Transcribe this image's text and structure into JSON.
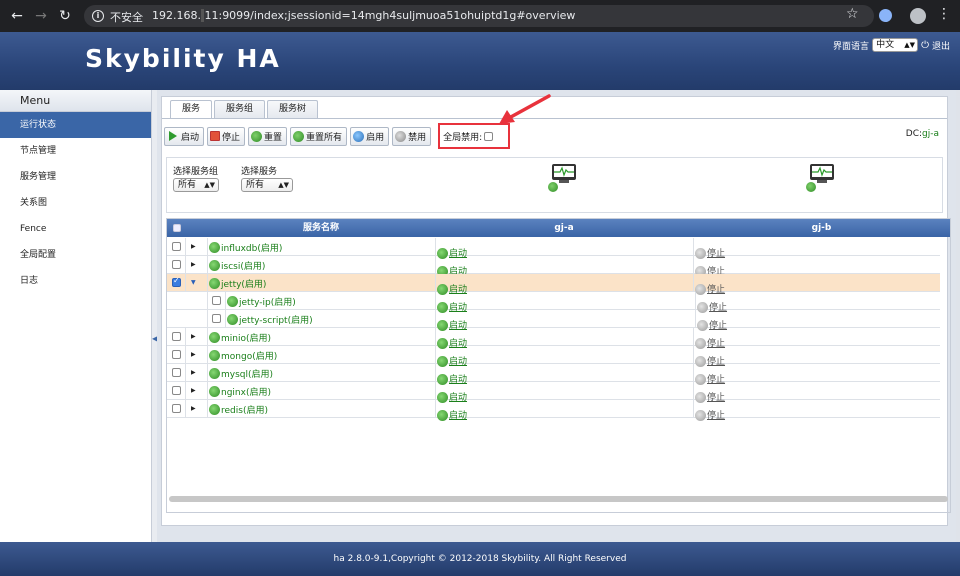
{
  "browser": {
    "insecure_label": "不安全",
    "url_host": "192.168.",
    "url_masked": "   ",
    "url_rest": "11:9099/index;jsessionid=14mgh4suljmuoa51ohuiptd1g#overview"
  },
  "header": {
    "logo": "Skybility HA",
    "lang_label": "界面语言",
    "lang_value": "中文",
    "logout_label": "退出"
  },
  "sidebar": {
    "title": "Menu",
    "items": [
      {
        "label": "运行状态",
        "active": true
      },
      {
        "label": "节点管理"
      },
      {
        "label": "服务管理"
      },
      {
        "label": "关系图"
      },
      {
        "label": "Fence"
      },
      {
        "label": "全局配置"
      },
      {
        "label": "日志"
      }
    ]
  },
  "tabs": [
    "服务",
    "服务组",
    "服务树"
  ],
  "toolbar": {
    "start": "启动",
    "stop": "停止",
    "reset": "重置",
    "reset_all": "重置所有",
    "enable": "启用",
    "disable": "禁用",
    "global_disable": "全局禁用:",
    "dc_label": "DC:",
    "dc_value": "gj-a"
  },
  "filters": {
    "group_label": "选择服务组",
    "group_value": "所有",
    "service_label": "选择服务",
    "service_value": "所有"
  },
  "grid": {
    "col_name": "服务名称",
    "col_node1": "gj-a",
    "col_node2": "gj-b",
    "rows": [
      {
        "name": "influxdb(启用)",
        "a": "启动",
        "b": "停止"
      },
      {
        "name": "iscsi(启用)",
        "a": "启动",
        "b": "停止"
      },
      {
        "name": "jetty(启用)",
        "a": "启动",
        "b": "停止"
      },
      {
        "name": "jetty-ip(启用)",
        "a": "启动",
        "b": "停止"
      },
      {
        "name": "jetty-script(启用)",
        "a": "启动",
        "b": "停止"
      },
      {
        "name": "minio(启用)",
        "a": "启动",
        "b": "停止"
      },
      {
        "name": "mongo(启用)",
        "a": "启动",
        "b": "停止"
      },
      {
        "name": "mysql(启用)",
        "a": "启动",
        "b": "停止"
      },
      {
        "name": "nginx(启用)",
        "a": "启动",
        "b": "停止"
      },
      {
        "name": "redis(启用)",
        "a": "启动",
        "b": "停止"
      }
    ]
  },
  "footer": "ha 2.8.0-9.1,Copyright © 2012-2018 Skybility. All Right Reserved",
  "colors": {
    "brand": "#2a4579",
    "status_green": "#1a7f1a",
    "highlight": "#e8323c"
  }
}
